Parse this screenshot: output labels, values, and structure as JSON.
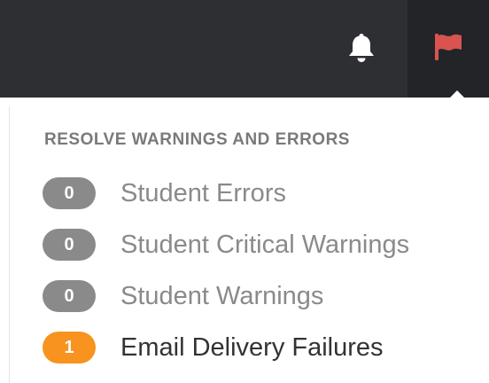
{
  "colors": {
    "topbar": "#2d2f33",
    "flag_button_bg": "#222428",
    "flag_icon": "#d9534f",
    "bell_icon": "#ffffff",
    "badge_zero": "#8a8a8a",
    "badge_alert": "#f7931e"
  },
  "topbar": {
    "icons": [
      "bell-icon",
      "flag-icon"
    ]
  },
  "dropdown": {
    "heading": "RESOLVE WARNINGS AND ERRORS",
    "items": [
      {
        "count": "0",
        "label": "Student Errors"
      },
      {
        "count": "0",
        "label": "Student Critical Warnings"
      },
      {
        "count": "0",
        "label": "Student Warnings"
      },
      {
        "count": "1",
        "label": "Email Delivery Failures"
      }
    ]
  }
}
